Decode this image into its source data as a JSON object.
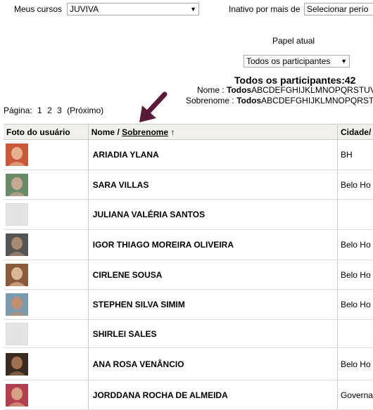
{
  "filters": {
    "courses_label": "Meus cursos",
    "course_value": "JUVIVA",
    "inactive_label": "Inativo por mais de",
    "inactive_value": "Selecionar perío",
    "role_label": "Papel atual",
    "role_value": "Todos os participantes"
  },
  "summary": {
    "title": "Todos os participantes:42",
    "firstname_label": "Nome :",
    "all_label": "Todos",
    "firstname_letters": "ABCDEFGHIJKLMNOPQRSTUV",
    "lastname_label": "Sobrenome :",
    "lastname_letters": "ABCDEFGHIJKLMNOPQRST"
  },
  "pagination": {
    "label": "Página:",
    "pages": [
      "1",
      "2",
      "3"
    ],
    "next": "(Próximo)"
  },
  "table": {
    "headers": {
      "photo": "Foto do usuário",
      "name_prefix": "Nome /",
      "sort_label": "Sobrenome",
      "sort_icon": "↑",
      "city": "Cidade/"
    },
    "rows": [
      {
        "name": "ARIADIA YLANA",
        "city": "BH",
        "avatar": "photo"
      },
      {
        "name": "SARA VILLAS",
        "city": "Belo Ho",
        "avatar": "photo"
      },
      {
        "name": "JULIANA VALÉRIA SANTOS",
        "city": "",
        "avatar": "default"
      },
      {
        "name": "IGOR THIAGO MOREIRA OLIVEIRA",
        "city": "Belo Ho",
        "avatar": "photo"
      },
      {
        "name": "CIRLENE SOUSA",
        "city": "Belo Ho",
        "avatar": "photo"
      },
      {
        "name": "STEPHEN SILVA SIMIM",
        "city": "Belo Ho",
        "avatar": "photo"
      },
      {
        "name": "SHIRLEI SALES",
        "city": "",
        "avatar": "default"
      },
      {
        "name": "ANA ROSA VENÂNCIO",
        "city": "Belo Ho",
        "avatar": "photo"
      },
      {
        "name": "JORDDANA ROCHA DE ALMEIDA",
        "city": "Governa",
        "avatar": "photo"
      }
    ]
  },
  "colors": {
    "arrow": "#5a1a3a",
    "header_bg": "#f2f0ec"
  }
}
